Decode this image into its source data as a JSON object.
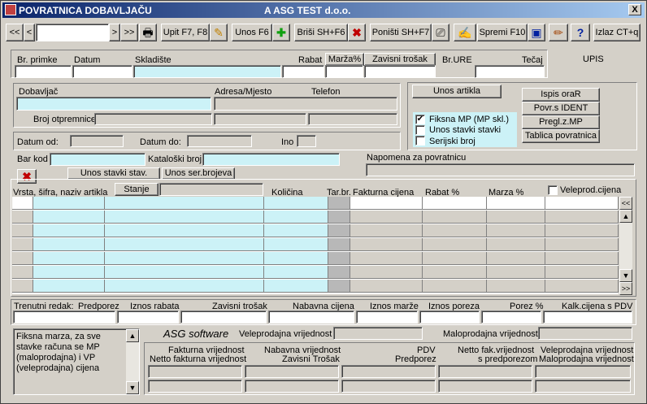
{
  "window": {
    "title": "POVRATNICA DOBAVLJAČU",
    "company": "A ASG TEST d.o.o.",
    "close": "X"
  },
  "toolbar": {
    "first": "<<",
    "prev": "<",
    "next": ">",
    "last": ">>",
    "upit": "Upit F7, F8",
    "unos": "Unos F6",
    "brisi": "Briši  SH+F6",
    "ponisti": "Poništi SH+F7",
    "spremi": "Spremi F10",
    "help": "?",
    "izlaz": "Izlaz CT+q"
  },
  "header": {
    "br_primke": "Br. primke",
    "datum": "Datum",
    "skladiste": "Skladište",
    "rabat": "Rabat",
    "marza": "Marža%",
    "zavisni": "Zavisni trošak",
    "br_ure": "Br.URE",
    "tecaj": "Tečaj",
    "upis": "UPIS"
  },
  "supplier": {
    "dobavljac": "Dobavljač",
    "adresa": "Adresa/Mjesto",
    "telefon": "Telefon",
    "broj_otpremnice": "Broj otpremnice"
  },
  "dates": {
    "datum_od": "Datum od:",
    "datum_do": "Datum do:",
    "ino": "Ino"
  },
  "right_panel": {
    "unos_artikla": "Unos artikla",
    "fiksna": "Fiksna MP (MP skl.)",
    "fiksna_checked": true,
    "unos_stavki": "Unos stavki stavki",
    "serijski": "Serijski broj",
    "ispis": "Ispis oraR",
    "povr": "Povr.s IDENT",
    "pregl": "Pregl.z.MP",
    "tablica": "Tablica povratnica"
  },
  "search": {
    "bar_kod": "Bar kod",
    "katalog": "Kataloški broj",
    "napomena": "Napomena za povratnicu",
    "unos_stav": "Unos stavki stav.",
    "unos_ser": "Unos ser.brojeva"
  },
  "grid": {
    "vrsta": "Vrsta, šifra, naziv artikla",
    "stanje": "Stanje",
    "kolicina": "Količina",
    "tarbr": "Tar.br.",
    "fakt": "Fakturna cijena",
    "rabat": "Rabat %",
    "marza": "Marza %",
    "veleprod": "Veleprod.cijena",
    "scroll_top": "<<",
    "scroll_bottom": ">>"
  },
  "totals": {
    "trenutni": "Trenutni redak:",
    "predporez": "Predporez",
    "iznos_rabata": "Iznos rabata",
    "zavisni": "Zavisni trošak",
    "nabavna": "Nabavna cijena",
    "iznos_marze": "Iznos marže",
    "iznos_poreza": "Iznos poreza",
    "porez": "Porez %",
    "kalk": "Kalk.cijena s PDV"
  },
  "footer": {
    "note": "Fiksna marza, za sve stavke računa se MP (maloprodajna) i VP (veleprodajna) cijena",
    "asg": "ASG software",
    "veleprodajna": "Veleprodajna vrijednost",
    "maloprodajna": "Maloprodajna vrijednost",
    "fakturna": "Fakturna vrijednost",
    "netto_fakt": "Netto fakturna vrijednost",
    "nabavna": "Nabavna vrijednost",
    "zavisni": "Zavisni Trošak",
    "pdv": "PDV",
    "predporez": "Predporez",
    "netto_fak": "Netto fak.vrijednost",
    "s_predporezom": "s predporezom",
    "vp_vr": "Veleprodajna vrijednost",
    "mp_vr": "Maloprodajna vrijednost"
  }
}
